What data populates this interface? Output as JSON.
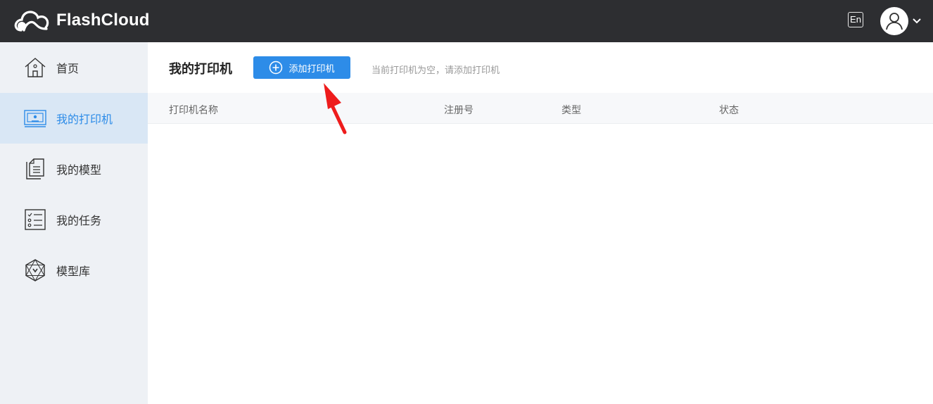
{
  "app": {
    "name": "FlashCloud"
  },
  "topbar": {
    "lang_label": "En"
  },
  "sidebar": {
    "items": [
      {
        "label": "首页",
        "icon": "home-icon",
        "active": false
      },
      {
        "label": "我的打印机",
        "icon": "printer-icon",
        "active": true
      },
      {
        "label": "我的模型",
        "icon": "document-icon",
        "active": false
      },
      {
        "label": "我的任务",
        "icon": "task-list-icon",
        "active": false
      },
      {
        "label": "模型库",
        "icon": "model-library-icon",
        "active": false
      }
    ]
  },
  "main": {
    "title": "我的打印机",
    "add_button_label": "添加打印机",
    "empty_hint": "当前打印机为空，请添加打印机",
    "columns": [
      "打印机名称",
      "注册号",
      "类型",
      "状态"
    ]
  },
  "colors": {
    "topbar": "#2d2e31",
    "accent": "#2d8ce8",
    "sidebar_bg": "#eef1f5",
    "sidebar_active_bg": "#d9e7f5",
    "annotation_arrow": "#ee1c1c"
  }
}
